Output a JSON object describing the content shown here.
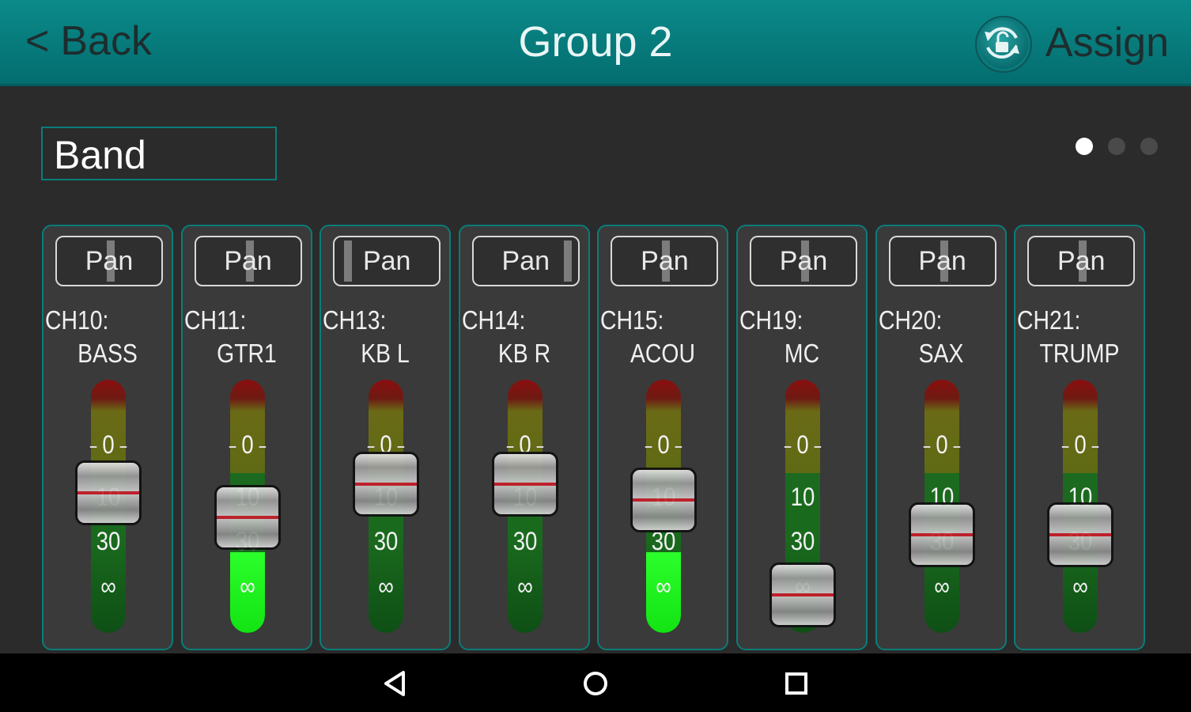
{
  "header": {
    "back_chevron": "<",
    "back_label": "Back",
    "title": "Group 2",
    "lock_icon": "rotate-unlock-icon",
    "assign_label": "Assign"
  },
  "group_name": "Band",
  "pager": {
    "count": 3,
    "active_index": 0,
    "active_color": "#ffffff",
    "inactive_color": "#4a4a4a"
  },
  "scale_labels": {
    "zero": "0",
    "ten": "10",
    "thirty": "30",
    "inf": "∞"
  },
  "channels": [
    {
      "channel": "CH10:",
      "name": "BASS",
      "pan_label": "Pan",
      "pan": 0.5,
      "fader_pct": 0.56,
      "signal_pct": 0.0
    },
    {
      "channel": "CH11:",
      "name": "GTR1",
      "pan_label": "Pan",
      "pan": 0.5,
      "fader_pct": 0.45,
      "signal_pct": 0.32
    },
    {
      "channel": "CH13:",
      "name": "KB L",
      "pan_label": "Pan",
      "pan": 0.05,
      "fader_pct": 0.6,
      "signal_pct": 0.0
    },
    {
      "channel": "CH14:",
      "name": "KB R",
      "pan_label": "Pan",
      "pan": 0.95,
      "fader_pct": 0.6,
      "signal_pct": 0.0
    },
    {
      "channel": "CH15:",
      "name": "ACOU",
      "pan_label": "Pan",
      "pan": 0.5,
      "fader_pct": 0.53,
      "signal_pct": 0.32
    },
    {
      "channel": "CH19:",
      "name": "MC",
      "pan_label": "Pan",
      "pan": 0.5,
      "fader_pct": 0.1,
      "signal_pct": 0.0
    },
    {
      "channel": "CH20:",
      "name": "SAX",
      "pan_label": "Pan",
      "pan": 0.5,
      "fader_pct": 0.37,
      "signal_pct": 0.0
    },
    {
      "channel": "CH21:",
      "name": "TRUMP",
      "pan_label": "Pan",
      "pan": 0.5,
      "fader_pct": 0.37,
      "signal_pct": 0.0
    }
  ],
  "colors": {
    "header": "#0b8a8a",
    "accent": "#0a7d7a",
    "signal_green": "#1cff1c",
    "fader_line": "#c81f2b"
  },
  "navbar": {
    "back_icon": "nav-back-icon",
    "home_icon": "nav-home-icon",
    "recents_icon": "nav-recents-icon"
  }
}
